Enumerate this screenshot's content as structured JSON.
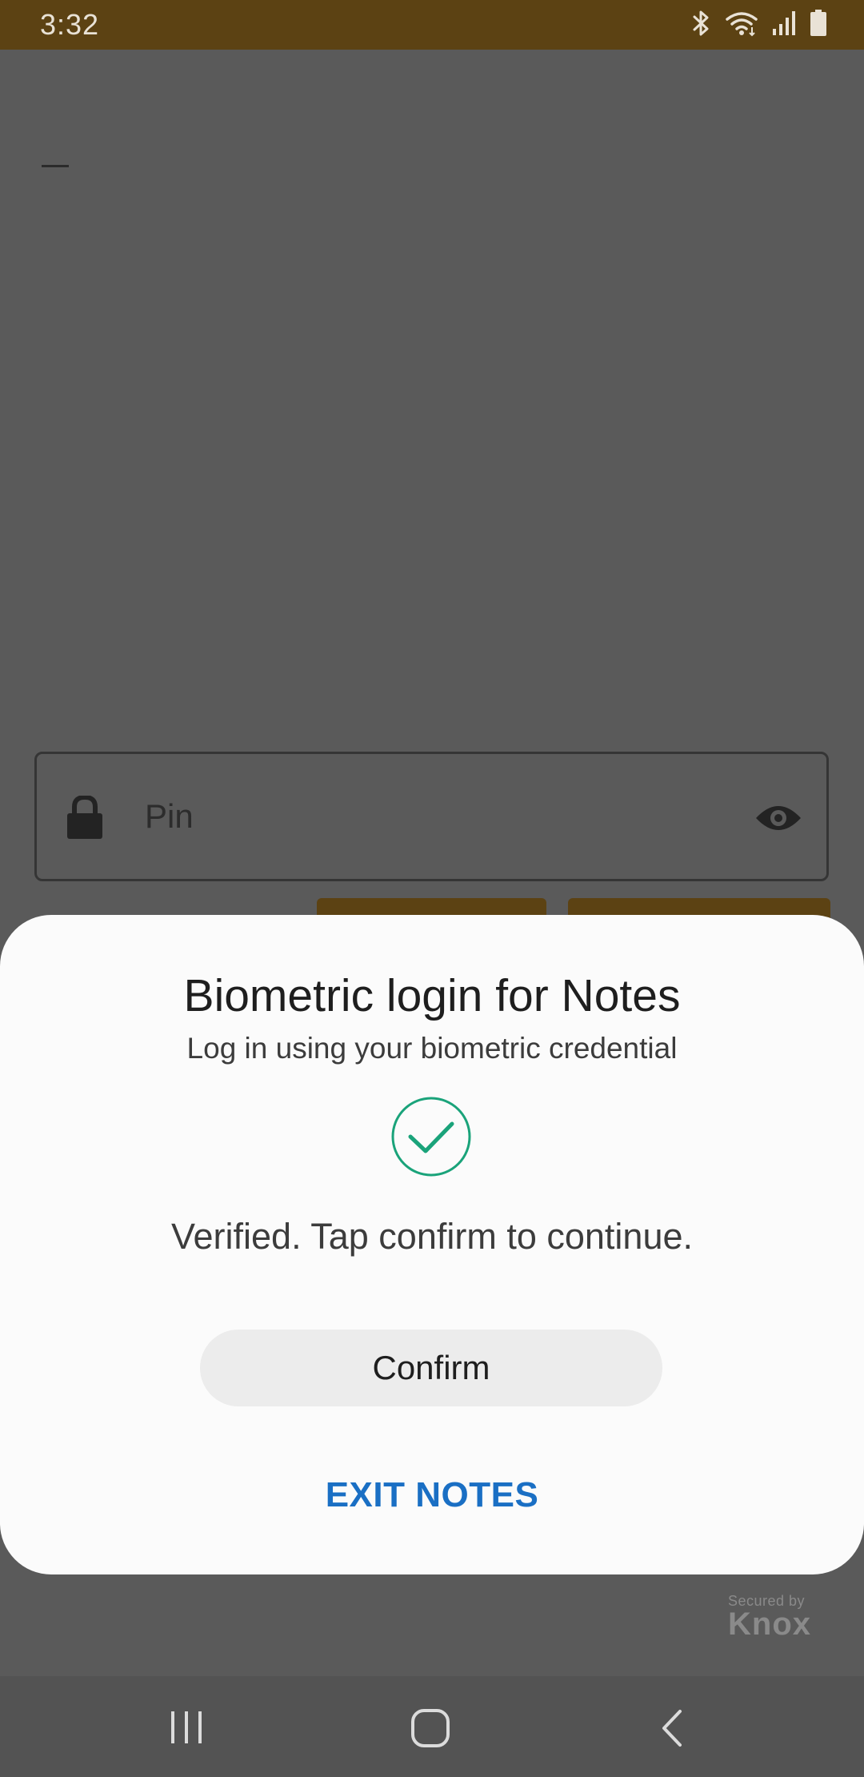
{
  "status_bar": {
    "time": "3:32",
    "icons": [
      "bluetooth-icon",
      "wifi-icon",
      "signal-icon",
      "battery-icon"
    ],
    "background_color": "#5c4213"
  },
  "background_app": {
    "pin_field": {
      "placeholder": "Pin",
      "leading_icon": "lock-icon",
      "trailing_icon": "eye-icon"
    }
  },
  "dialog": {
    "title": "Biometric login for Notes",
    "subtitle": "Log in using your biometric credential",
    "status_icon": "check-circle-icon",
    "status_text": "Verified. Tap confirm to continue.",
    "confirm_label": "Confirm",
    "exit_label": "EXIT NOTES",
    "accent_color": "#1a6fc4",
    "check_color": "#1aa37a"
  },
  "branding": {
    "secured_by": "Secured by",
    "knox": "Knox"
  },
  "nav_bar": {
    "buttons": [
      "recents-icon",
      "home-icon",
      "back-icon"
    ]
  }
}
